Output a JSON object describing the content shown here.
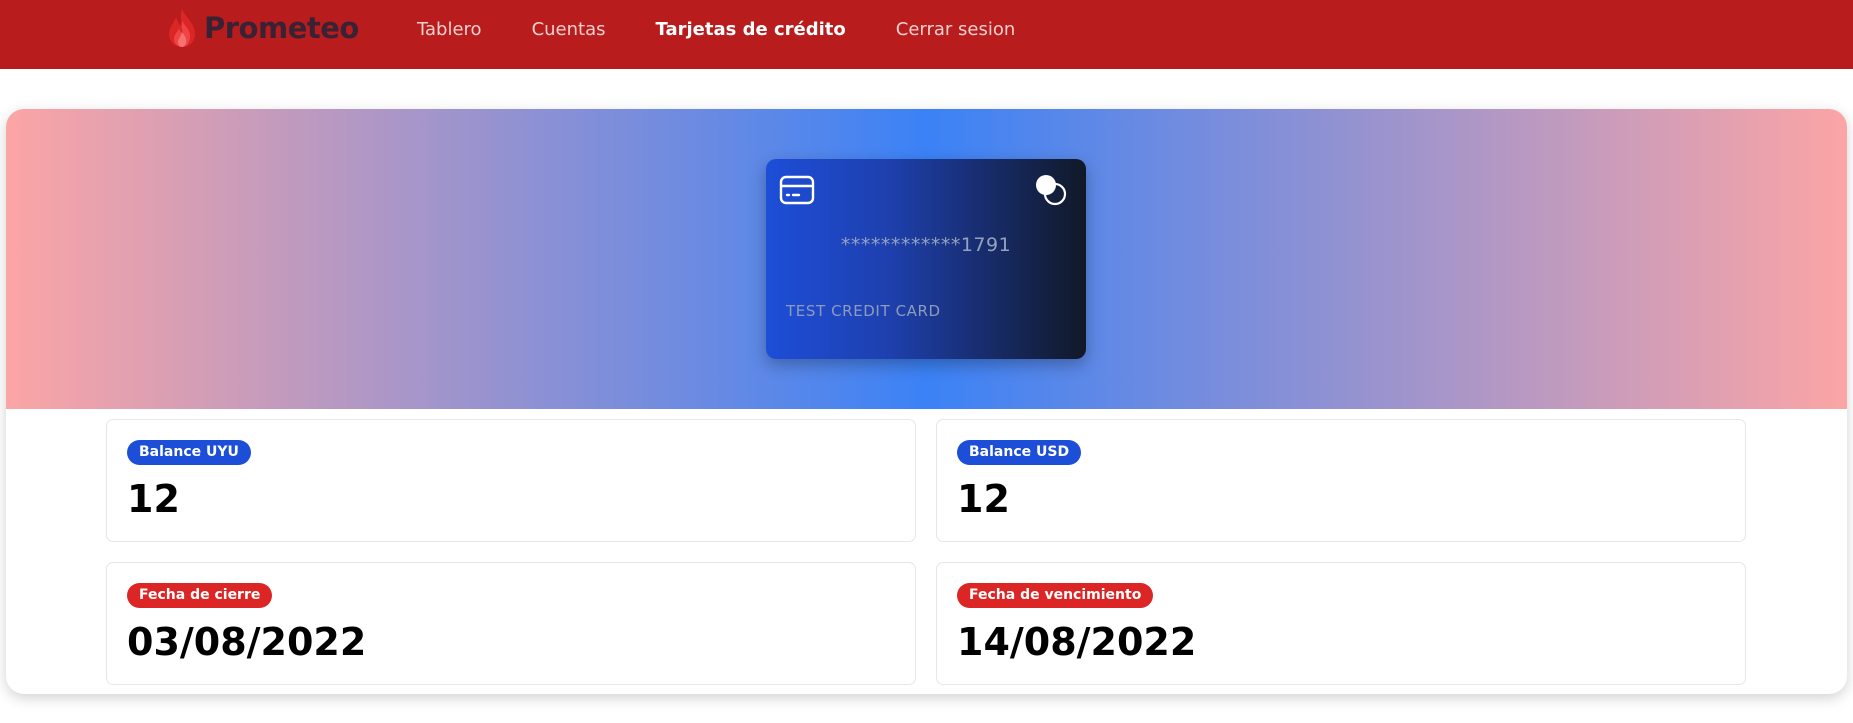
{
  "navbar": {
    "brand_name": "Prometeo",
    "brand_color": "#b91c1c",
    "links": [
      {
        "label": "Tablero",
        "active": false
      },
      {
        "label": "Cuentas",
        "active": false
      },
      {
        "label": "Tarjetas de crédito",
        "active": true
      },
      {
        "label": "Cerrar sesion",
        "active": false
      }
    ]
  },
  "hero": {
    "gradient_colors": [
      "#fca5a5",
      "#3b82f6",
      "#fca5a5"
    ]
  },
  "card": {
    "icon": "credit-card-icon",
    "brand_icon": "card-brand-circles-icon",
    "number": "************1791",
    "holder": "TEST CREDIT CARD"
  },
  "stats": [
    {
      "badge": "Balance UYU",
      "value": "12",
      "badge_color": "#1d4ed8"
    },
    {
      "badge": "Balance USD",
      "value": "12",
      "badge_color": "#1d4ed8"
    },
    {
      "badge": "Fecha de cierre",
      "value": "03/08/2022",
      "badge_color": "#dc2626"
    },
    {
      "badge": "Fecha de vencimiento",
      "value": "14/08/2022",
      "badge_color": "#dc2626"
    }
  ]
}
